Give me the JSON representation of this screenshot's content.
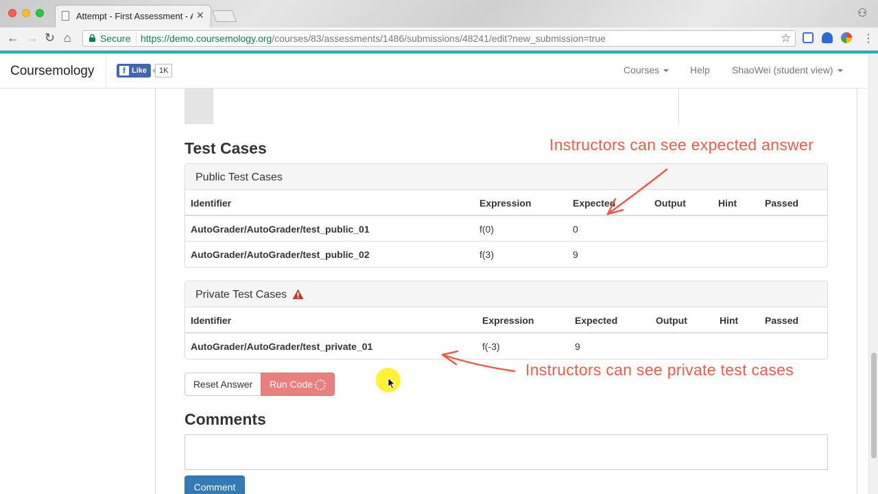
{
  "browser": {
    "tab_title": "Attempt - First Assessment - A",
    "secure_label": "Secure",
    "url_scheme": "https://",
    "url_host": "demo.coursemology.org",
    "url_path": "/courses/83/assessments/1486/submissions/48241/edit?new_submission=true"
  },
  "navbar": {
    "brand": "Coursemology",
    "fb_like_label": "Like",
    "fb_like_count": "1K",
    "links": {
      "courses": "Courses",
      "help": "Help",
      "user": "ShaoWei (student view)"
    }
  },
  "test_cases": {
    "heading": "Test Cases",
    "public": {
      "title": "Public Test Cases",
      "columns": [
        "Identifier",
        "Expression",
        "Expected",
        "Output",
        "Hint",
        "Passed"
      ],
      "rows": [
        {
          "identifier": "AutoGrader/AutoGrader/test_public_01",
          "expression": "f(0)",
          "expected": "0",
          "output": "",
          "hint": "",
          "passed": ""
        },
        {
          "identifier": "AutoGrader/AutoGrader/test_public_02",
          "expression": "f(3)",
          "expected": "9",
          "output": "",
          "hint": "",
          "passed": ""
        }
      ]
    },
    "private": {
      "title": "Private Test Cases",
      "warning_icon": "warning-triangle-icon",
      "columns": [
        "Identifier",
        "Expression",
        "Expected",
        "Output",
        "Hint",
        "Passed"
      ],
      "rows": [
        {
          "identifier": "AutoGrader/AutoGrader/test_private_01",
          "expression": "f(-3)",
          "expected": "9",
          "output": "",
          "hint": "",
          "passed": ""
        }
      ]
    }
  },
  "actions": {
    "reset_label": "Reset Answer",
    "run_label": "Run Code"
  },
  "comments": {
    "heading": "Comments",
    "submit_label": "Comment"
  },
  "annotations": {
    "expected": "Instructors can see expected answer",
    "private": "Instructors can see private test cases"
  },
  "colors": {
    "accent_teal": "#18b3c7",
    "annotation_red": "#f05a46",
    "run_button": "#e9807d",
    "primary_blue": "#337ab7"
  }
}
